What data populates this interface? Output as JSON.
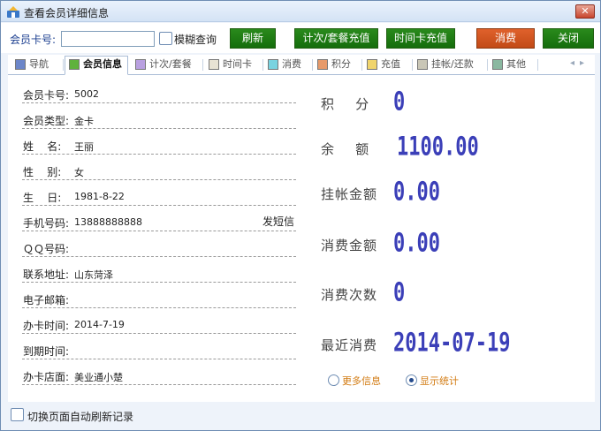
{
  "window": {
    "title": "查看会员详细信息",
    "close_glyph": "✕"
  },
  "toolbar": {
    "card_label": "会员卡号:",
    "card_value": "",
    "fuzzy_label": "模糊查询",
    "refresh": "刷新",
    "count_recharge": "计次/套餐充值",
    "time_recharge": "时间卡充值",
    "consume": "消费",
    "close": "关闭"
  },
  "tabs": [
    {
      "label": "导航",
      "color": "#6c86c9"
    },
    {
      "label": "会员信息",
      "color": "#5fb23c"
    },
    {
      "label": "计次/套餐",
      "color": "#b9a0e0"
    },
    {
      "label": "时间卡",
      "color": "#e8e3d4"
    },
    {
      "label": "消费",
      "color": "#79d3e0"
    },
    {
      "label": "积分",
      "color": "#e79a6a"
    },
    {
      "label": "充值",
      "color": "#f0d46c"
    },
    {
      "label": "挂帐/还款",
      "color": "#c9c6b6"
    },
    {
      "label": "其他",
      "color": "#8ab8a0"
    }
  ],
  "fields": [
    {
      "label": "会员卡号:",
      "value": "5002"
    },
    {
      "label": "会员类型:",
      "value": "金卡"
    },
    {
      "label": "姓    名:",
      "value": "王丽"
    },
    {
      "label": "性    别:",
      "value": "女"
    },
    {
      "label": "生    日:",
      "value": "1981-8-22"
    },
    {
      "label": "手机号码:",
      "value": "13888888888",
      "action": "发短信"
    },
    {
      "label": "ＱＱ号码:",
      "value": ""
    },
    {
      "label": "联系地址:",
      "value": "山东菏泽"
    },
    {
      "label": "电子邮箱:",
      "value": ""
    },
    {
      "label": "办卡时间:",
      "value": "2014-7-19"
    },
    {
      "label": "到期时间:",
      "value": ""
    },
    {
      "label": "办卡店面:",
      "value": "美业通小楚"
    }
  ],
  "stats": [
    {
      "label": "积    分",
      "value": "0"
    },
    {
      "label": "余    额",
      "value": "1100.00"
    },
    {
      "label": "挂帐金额",
      "value": "0.00"
    },
    {
      "label": "消费金额",
      "value": "0.00"
    },
    {
      "label": "消费次数",
      "value": "0"
    },
    {
      "label": "最近消费",
      "value": "2014-07-19"
    }
  ],
  "options": {
    "more_info": "更多信息",
    "show_stats": "显示统计"
  },
  "footer": {
    "auto_refresh": "切换页面自动刷新记录"
  }
}
